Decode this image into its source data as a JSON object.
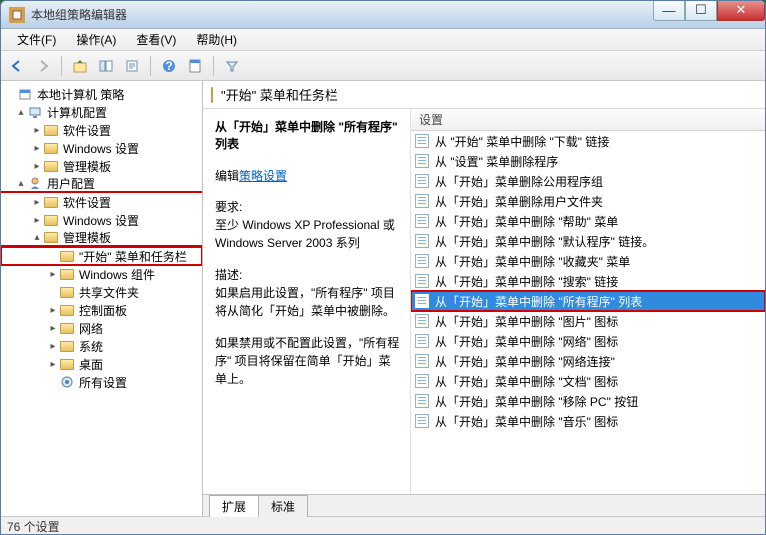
{
  "window": {
    "title": "本地组策略编辑器"
  },
  "menu": {
    "file": "文件(F)",
    "action": "操作(A)",
    "view": "查看(V)",
    "help": "帮助(H)"
  },
  "tree": {
    "root": "本地计算机 策略",
    "computer_cfg": "计算机配置",
    "cc_soft": "软件设置",
    "cc_win": "Windows 设置",
    "cc_admin": "管理模板",
    "user_cfg": "用户配置",
    "uc_soft": "软件设置",
    "uc_win": "Windows 设置",
    "uc_admin": "管理模板",
    "start_taskbar": "\"开始\" 菜单和任务栏",
    "win_comp": "Windows 组件",
    "share": "共享文件夹",
    "ctrl_panel": "控制面板",
    "network": "网络",
    "system": "系统",
    "desktop": "桌面",
    "all_set": "所有设置"
  },
  "crumb": {
    "title": "\"开始\" 菜单和任务栏"
  },
  "desc": {
    "title": "从「开始」菜单中删除 \"所有程序\" 列表",
    "edit_prefix": "编辑",
    "edit_link": "策略设置",
    "req_label": "要求:",
    "req_text": "至少 Windows XP Professional 或 Windows Server 2003 系列",
    "desc_label": "描述:",
    "desc_text1": "如果启用此设置，\"所有程序\" 项目将从简化「开始」菜单中被删除。",
    "desc_text2": "如果禁用或不配置此设置，\"所有程序\" 项目将保留在简单「开始」菜单上。"
  },
  "list": {
    "header": "设置",
    "items": [
      "从 \"开始\" 菜单中删除 \"下载\" 链接",
      "从 \"设置\" 菜单删除程序",
      "从「开始」菜单删除公用程序组",
      "从「开始」菜单删除用户文件夹",
      "从「开始」菜单中删除 \"帮助\" 菜单",
      "从「开始」菜单中删除 \"默认程序\" 链接。",
      "从「开始」菜单中删除 \"收藏夹\" 菜单",
      "从「开始」菜单中删除 \"搜索\" 链接",
      "从「开始」菜单中删除 \"所有程序\" 列表",
      "从「开始」菜单中删除 \"图片\" 图标",
      "从「开始」菜单中删除 \"网络\" 图标",
      "从「开始」菜单中删除 \"网络连接\"",
      "从「开始」菜单中删除 \"文档\" 图标",
      "从「开始」菜单中删除 \"移除 PC\" 按钮",
      "从「开始」菜单中删除 \"音乐\" 图标"
    ],
    "selected_index": 8
  },
  "tabs": {
    "expand": "扩展",
    "standard": "标准"
  },
  "status": {
    "text": "76 个设置"
  }
}
